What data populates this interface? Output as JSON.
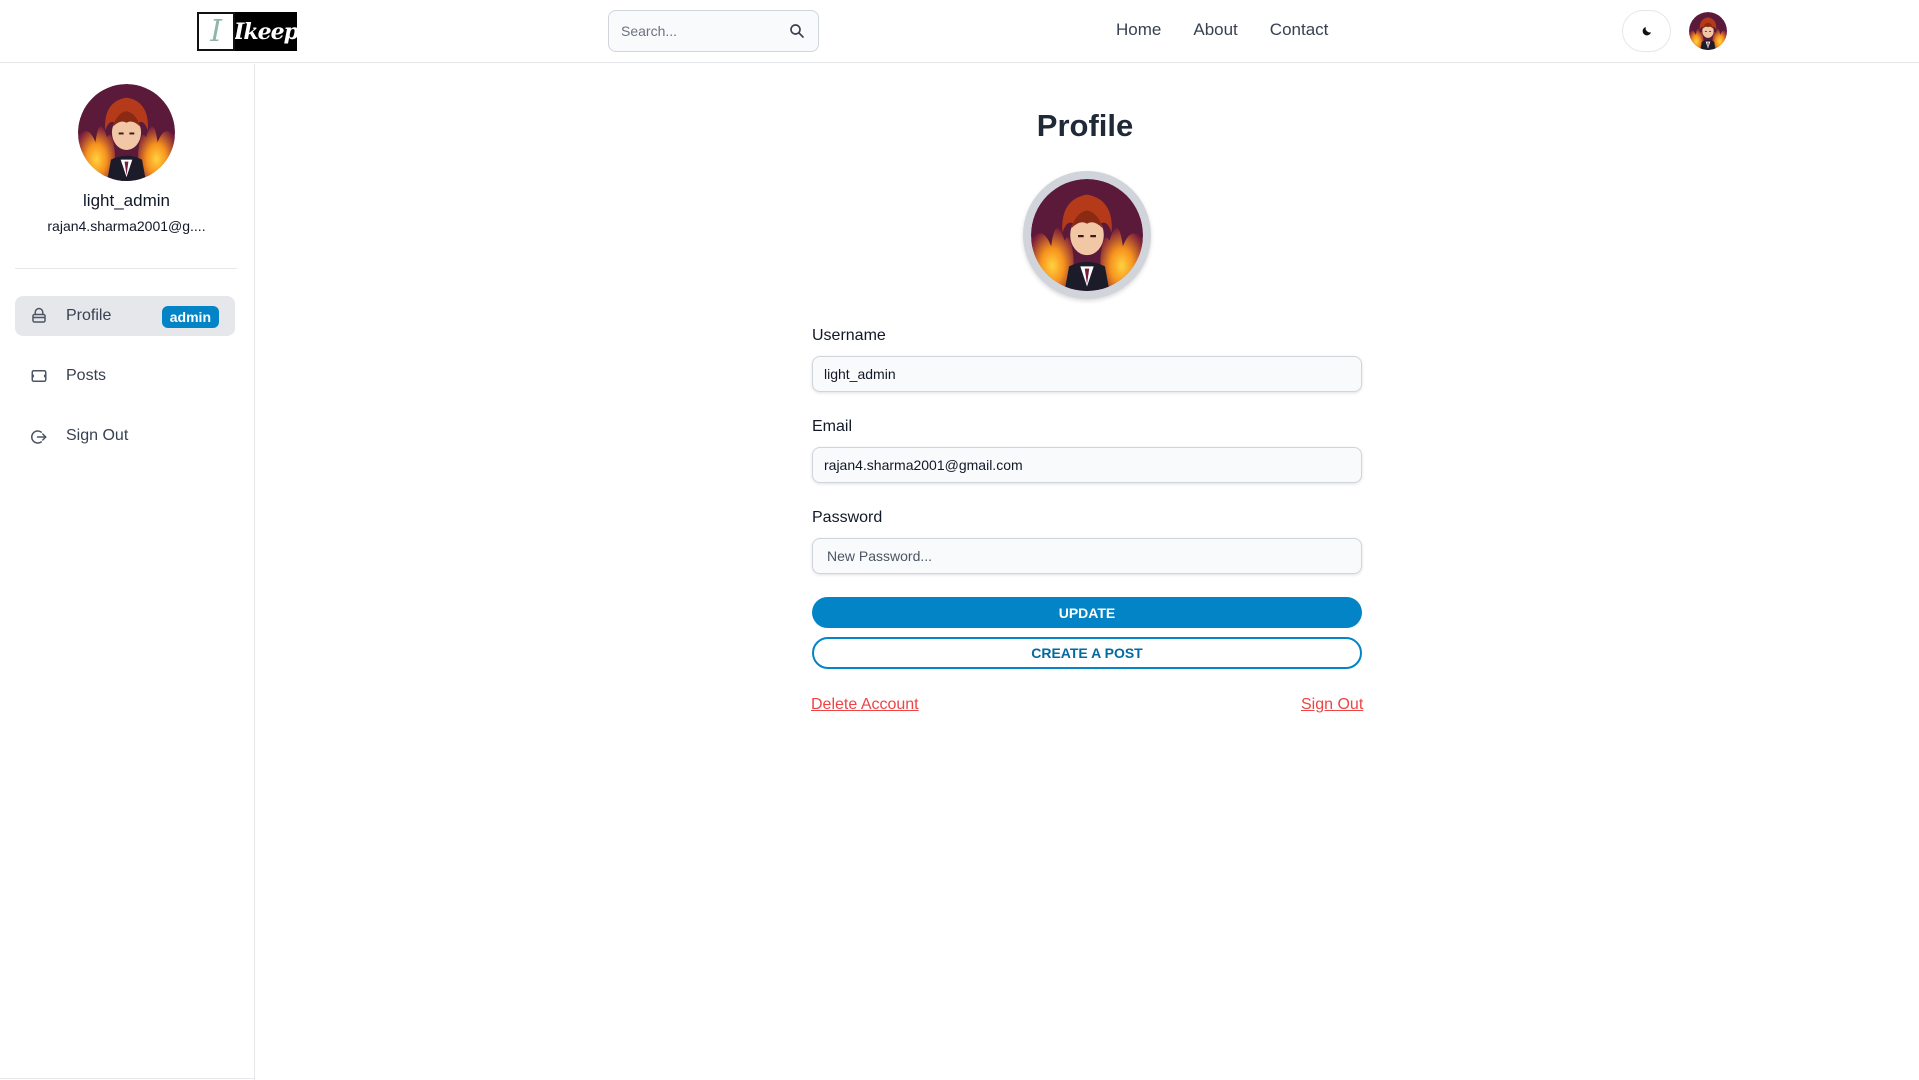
{
  "header": {
    "logo": {
      "letter": "I",
      "word": "Ikeep"
    },
    "search": {
      "placeholder": "Search...",
      "icon": "search-icon"
    },
    "nav": [
      {
        "label": "Home"
      },
      {
        "label": "About"
      },
      {
        "label": "Contact"
      }
    ],
    "theme_toggle_icon": "moon-icon"
  },
  "sidebar": {
    "username": "light_admin",
    "email": "rajan4.sharma2001@g....",
    "items": [
      {
        "label": "Profile",
        "icon": "user-icon",
        "badge": "admin",
        "active": true
      },
      {
        "label": "Posts",
        "icon": "posts-icon"
      },
      {
        "label": "Sign Out",
        "icon": "sign-out-icon"
      }
    ]
  },
  "profile": {
    "title": "Profile",
    "username_label": "Username",
    "username_value": "light_admin",
    "email_label": "Email",
    "email_value": "rajan4.sharma2001@gmail.com",
    "password_label": "Password",
    "password_placeholder": "New Password...",
    "update_label": "UPDATE",
    "create_post_label": "CREATE A POST",
    "delete_label": "Delete Account",
    "signout_label": "Sign Out"
  },
  "colors": {
    "accent": "#0284c7",
    "danger": "#ef4444",
    "border": "#e5e7eb"
  }
}
